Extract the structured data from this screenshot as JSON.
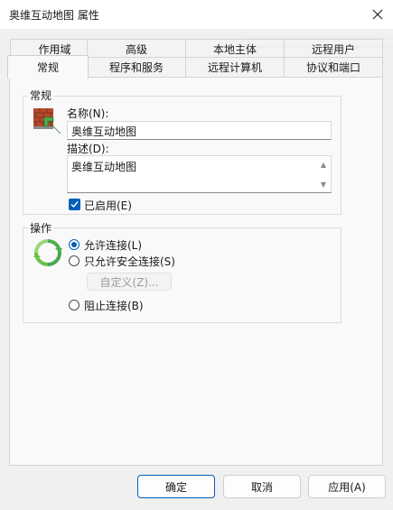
{
  "window": {
    "title": "奥维互动地图 属性"
  },
  "tabs_back": [
    "作用域",
    "高级",
    "本地主体",
    "远程用户"
  ],
  "tabs_front": [
    "常规",
    "程序和服务",
    "远程计算机",
    "协议和端口"
  ],
  "active_tab": "常规",
  "general": {
    "group_label": "常规",
    "name_label": "名称(N):",
    "name_value": "奥维互动地图",
    "desc_label": "描述(D):",
    "desc_value": "奥维互动地图",
    "enabled_label": "已启用(E)",
    "enabled": true
  },
  "action": {
    "group_label": "操作",
    "allow_label": "允许连接(L)",
    "allow_secure_label": "只允许安全连接(S)",
    "customize_label": "自定义(Z)...",
    "block_label": "阻止连接(B)",
    "selected": "allow"
  },
  "buttons": {
    "ok": "确定",
    "cancel": "取消",
    "apply": "应用(A)"
  },
  "colors": {
    "accent": "#005fb8",
    "brick": "#b34a2c",
    "arrow_green": "#4caf50"
  },
  "icons": [
    "close-icon",
    "firewall-brick-icon",
    "green-arrow-icon",
    "refresh-cycle-icon",
    "checkmark-icon",
    "scroll-up-icon",
    "scroll-down-icon"
  ]
}
